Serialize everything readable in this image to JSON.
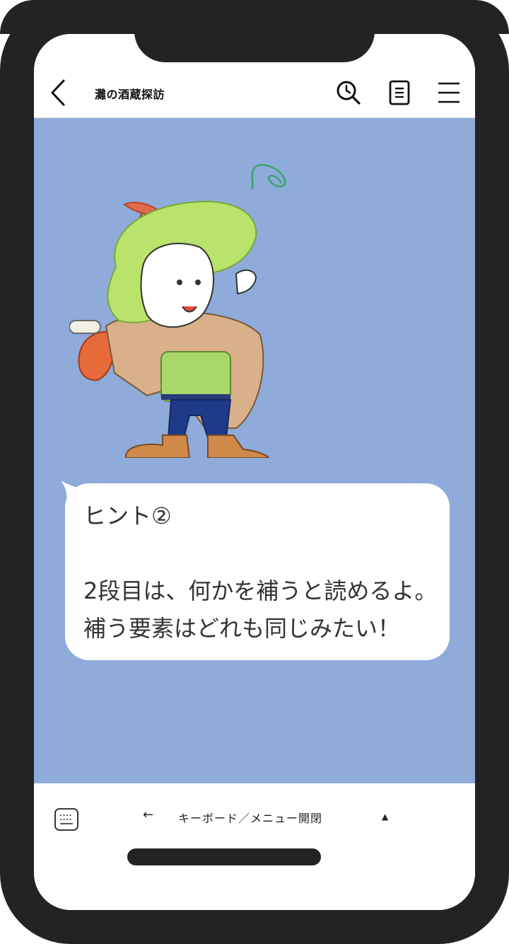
{
  "header": {
    "title": "灘の酒蔵探訪",
    "back_icon": "chevron-left-icon",
    "icons": [
      "clock-search-icon",
      "notes-icon",
      "menu-icon"
    ]
  },
  "chat": {
    "background_color": "#8eabda",
    "message": {
      "text": "ヒント②\n\n2段目は、何かを補うと読めるよ。\n補う要素はどれも同じみたい！"
    }
  },
  "footer": {
    "keyboard_icon": "keyboard-icon",
    "arrow": "←",
    "menu_label": "キーボード／メニュー開閉",
    "toggle_glyph": "▲"
  }
}
